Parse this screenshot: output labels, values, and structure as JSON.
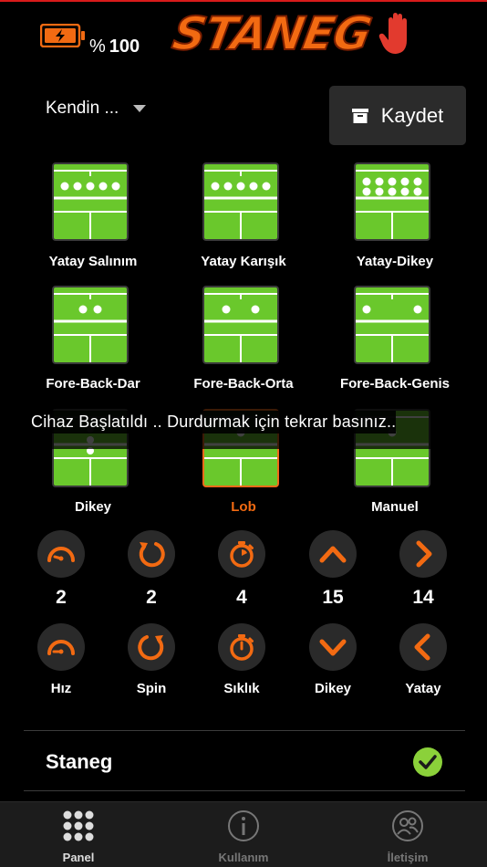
{
  "header": {
    "battery_percent_symbol": "%",
    "battery_value": "100",
    "logo_text": "STANEG"
  },
  "selector": {
    "label": "Kendin ..."
  },
  "save_button": {
    "label": "Kaydet"
  },
  "modes": [
    {
      "label": "Yatay Salınım"
    },
    {
      "label": "Yatay Karışık"
    },
    {
      "label": "Yatay-Dikey"
    },
    {
      "label": "Fore-Back-Dar"
    },
    {
      "label": "Fore-Back-Orta"
    },
    {
      "label": "Fore-Back-Genis"
    },
    {
      "label": "Dikey"
    },
    {
      "label": "Lob"
    },
    {
      "label": "Manuel"
    }
  ],
  "toast": "Cihaz Başlatıldı .. Durdurmak için tekrar basınız..",
  "controls": {
    "values": [
      "2",
      "2",
      "4",
      "15",
      "14"
    ],
    "labels": [
      "Hız",
      "Spin",
      "Sıklık",
      "Dikey",
      "Yatay"
    ]
  },
  "device": {
    "name": "Staneg"
  },
  "tabs": [
    {
      "label": "Panel"
    },
    {
      "label": "Kullanım"
    },
    {
      "label": "İletişim"
    }
  ],
  "colors": {
    "accent": "#f26a12",
    "court_green": "#6ac82c",
    "background": "#000000",
    "check_green": "#8bd13a"
  }
}
